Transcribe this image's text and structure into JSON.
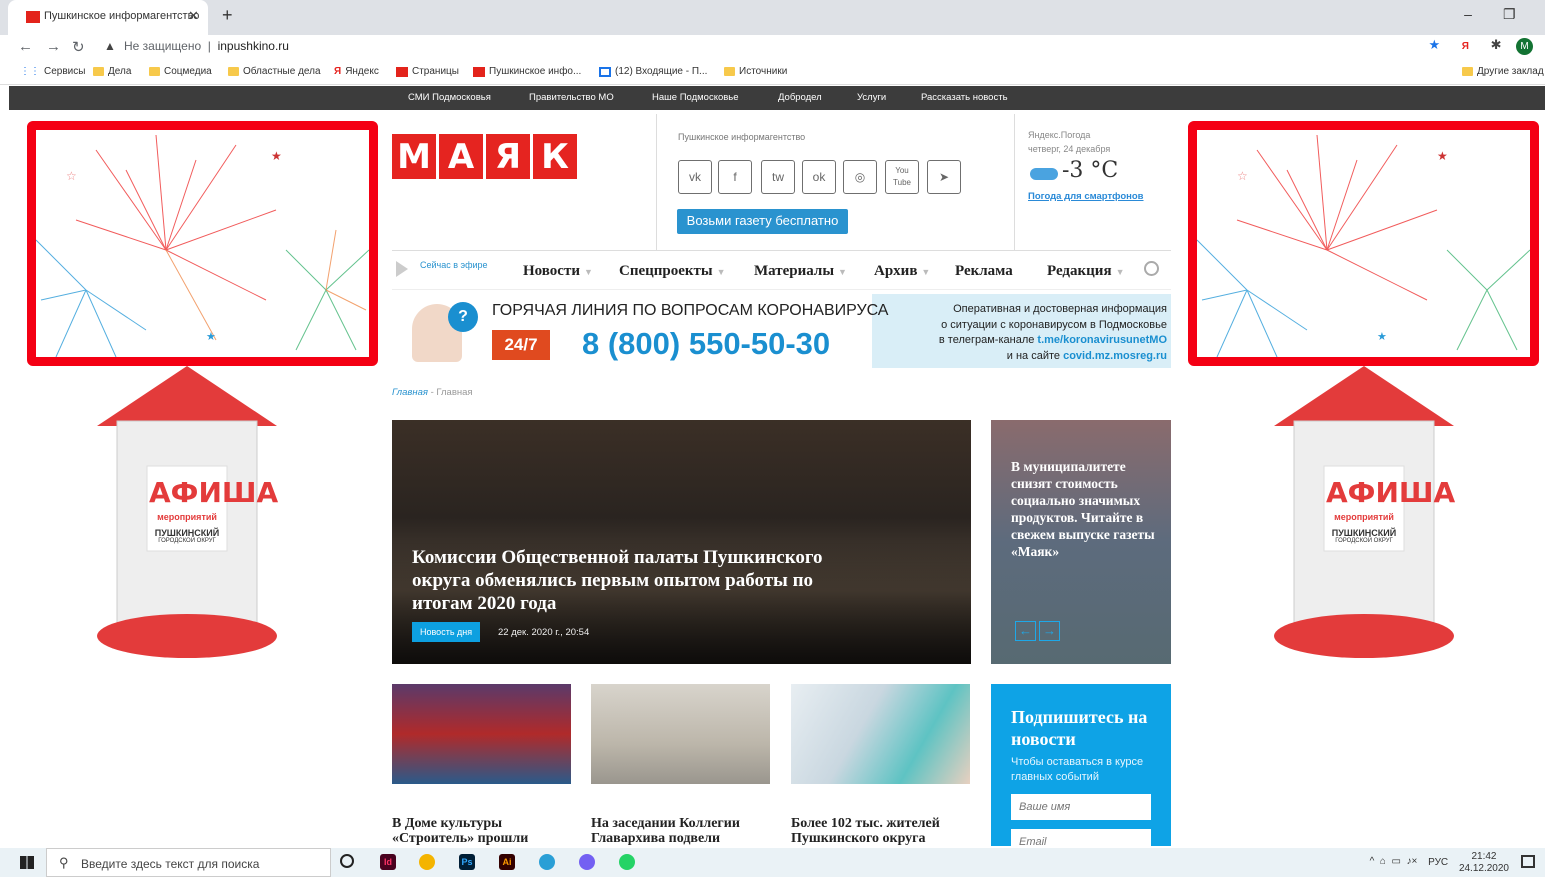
{
  "browser": {
    "tab_title": "Пушкинское информагентство",
    "new_tab": "+",
    "not_secure": "Не защищено",
    "url": "inpushkino.ru",
    "profile_initial": "M",
    "bookmarks": [
      "Сервисы",
      "Дела",
      "Соцмедиа",
      "Областные дела",
      "Яндекс",
      "Страницы",
      "Пушкинское инфо...",
      "(12) Входящие - П...",
      "Источники"
    ],
    "other_bookmarks": "Другие заклад"
  },
  "site": {
    "topnav": [
      "СМИ Подмосковья",
      "Правительство МО",
      "Наше Подмосковье",
      "Добродел",
      "Услуги",
      "Рассказать новость"
    ],
    "logo_letters": [
      "М",
      "А",
      "Я",
      "К"
    ],
    "agency": "Пушкинское информагентство",
    "social": [
      "vk",
      "f",
      "tw",
      "ok",
      "ig",
      "You Tube",
      "tg"
    ],
    "newspaper_btn": "Возьми газету бесплатно",
    "weather": {
      "source": "Яндекс.Погода",
      "date": "четверг, 24 декабря",
      "temp": "-3 °C",
      "link": "Погода для смартфонов"
    },
    "onair": "Сейчас в эфире",
    "menu": [
      "Новости",
      "Спецпроекты",
      "Материалы",
      "Архив",
      "Реклама",
      "Редакция"
    ],
    "banner": {
      "title": "ГОРЯЧАЯ ЛИНИЯ ПО ВОПРОСАМ КОРОНАВИРУСА",
      "badge": "24/7",
      "phone": "8 (800) 550-50-30",
      "info1": "Оперативная и достоверная информация",
      "info2": "о ситуации с коронавирусом в Подмосковье",
      "info3": "в телеграм-канале",
      "link1": "t.me/koronavirusunetMO",
      "info4": "и на сайте",
      "link2": "covid.mz.mosreg.ru"
    },
    "breadcrumbs": {
      "home": "Главная",
      "sep": " - ",
      "current": "Главная"
    },
    "hero": {
      "title": "Комиссии Общественной палаты Пушкинского округа обменялись первым опытом работы по итогам 2020 года",
      "badge": "Новость дня",
      "date": "22 дек. 2020 г., 20:54"
    },
    "side_story": "В муниципалитете снизят стоимость социально значимых продуктов. Читайте в свежем выпуске газеты «Маяк»",
    "cards": [
      "В Доме культуры «Строитель» прошли",
      "На заседании Коллегии Главархива подвели",
      "Более 102 тыс. жителей Пушкинского округа"
    ],
    "subscribe": {
      "title": "Подпишитесь на новости",
      "subtitle": "Чтобы оставаться в курсе главных событий",
      "name_ph": "Ваше имя",
      "email_ph": "Email"
    },
    "promo": {
      "title": "АФИША",
      "sub": "мероприятий",
      "city": "ПУШКИНСКИЙ",
      "district": "ГОРОДСКОЙ ОКРУГ"
    }
  },
  "taskbar": {
    "search": "Введите здесь текст для поиска",
    "lang": "РУС",
    "time": "21:42",
    "date": "24.12.2020"
  },
  "colors": {
    "brand_red": "#e52420",
    "accent_blue": "#0ea3e6",
    "promo_red": "#f40014"
  }
}
